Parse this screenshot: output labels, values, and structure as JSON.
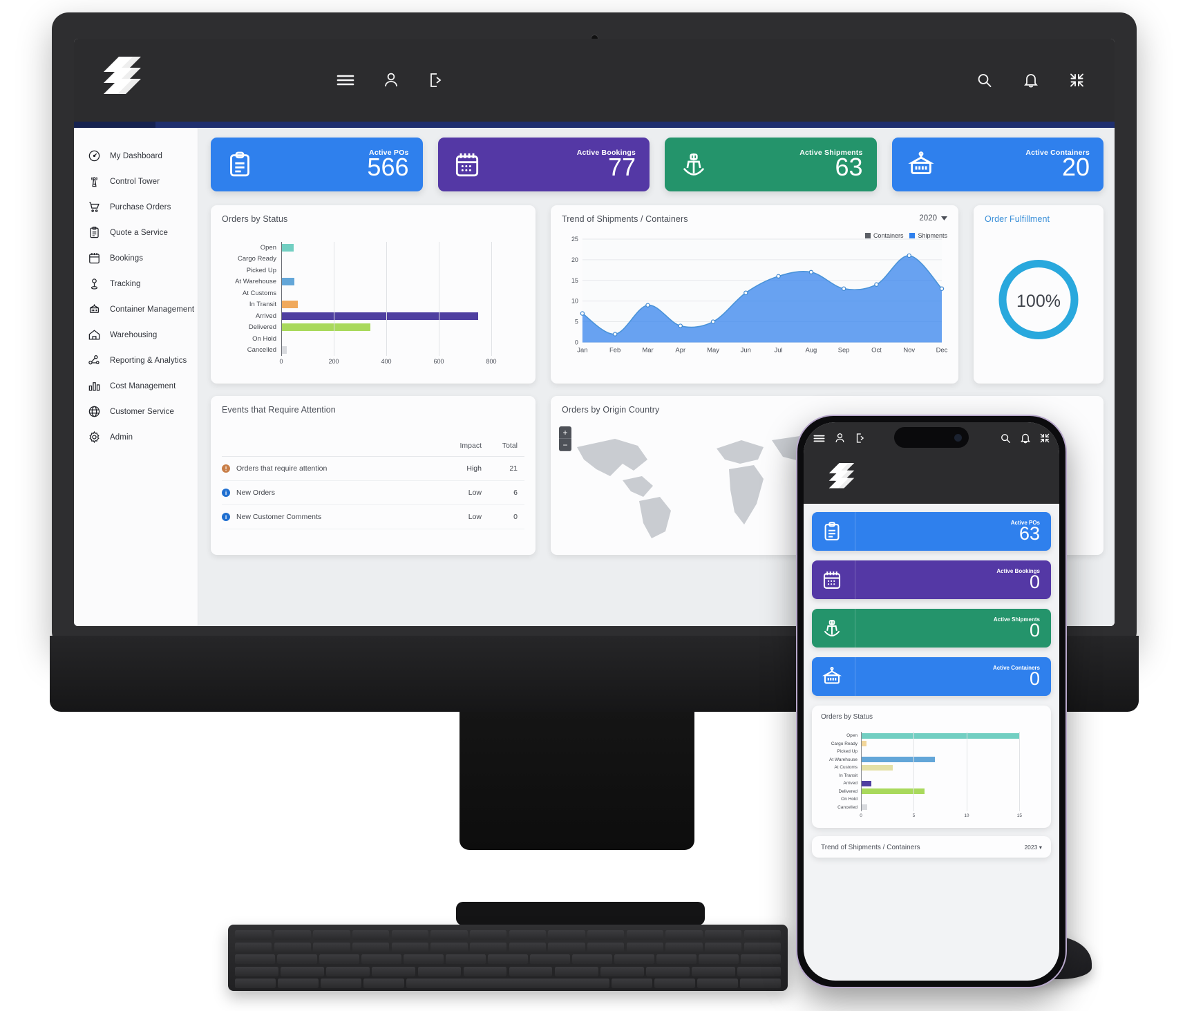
{
  "app": {
    "brand_logo": "stacked-slash-logo",
    "accent_navy": "#1f2f6e",
    "topbar_bg": "#2c2c2e"
  },
  "topbar": {
    "center_icons": [
      {
        "name": "menu-icon",
        "glyph": "hamburger"
      },
      {
        "name": "user-icon",
        "glyph": "person"
      },
      {
        "name": "logout-icon",
        "glyph": "exit-door"
      }
    ],
    "right_icons": [
      {
        "name": "search-icon",
        "glyph": "magnifier"
      },
      {
        "name": "notifications-icon",
        "glyph": "bell"
      },
      {
        "name": "fullscreen-icon",
        "glyph": "collapse-arrows"
      }
    ]
  },
  "sidebar": {
    "items": [
      {
        "label": "My Dashboard",
        "icon": "speedometer-icon"
      },
      {
        "label": "Control Tower",
        "icon": "broadcast-tower-icon"
      },
      {
        "label": "Purchase Orders",
        "icon": "shopping-cart-icon"
      },
      {
        "label": "Quote a Service",
        "icon": "clipboard-icon"
      },
      {
        "label": "Bookings",
        "icon": "calendar-icon"
      },
      {
        "label": "Tracking",
        "icon": "map-pin-icon"
      },
      {
        "label": "Container Management",
        "icon": "container-icon"
      },
      {
        "label": "Warehousing",
        "icon": "warehouse-icon"
      },
      {
        "label": "Reporting & Analytics",
        "icon": "network-nodes-icon"
      },
      {
        "label": "Cost Management",
        "icon": "bar-chart-icon"
      },
      {
        "label": "Customer Service",
        "icon": "globe-icon"
      },
      {
        "label": "Admin",
        "icon": "gear-icon"
      }
    ]
  },
  "kpis": [
    {
      "label": "Active POs",
      "value": "566",
      "color": "#2f80ed",
      "icon": "clipboard-icon"
    },
    {
      "label": "Active Bookings",
      "value": "77",
      "color": "#5438a5",
      "icon": "calendar-icon"
    },
    {
      "label": "Active Shipments",
      "value": "63",
      "color": "#24946b",
      "icon": "ship-icon"
    },
    {
      "label": "Active Containers",
      "value": "20",
      "color": "#2f80ed",
      "icon": "container-icon"
    }
  ],
  "panels": {
    "orders_by_status": {
      "title": "Orders by Status"
    },
    "trend": {
      "title": "Trend of Shipments / Containers",
      "year": "2020"
    },
    "fulfillment": {
      "title": "Order Fulfillment",
      "percent": "100%",
      "ring_color": "#29a8dd"
    },
    "events": {
      "title": "Events that Require Attention"
    },
    "origin": {
      "title": "Orders by Origin Country",
      "zoom_in": "+",
      "zoom_out": "−"
    }
  },
  "chart_data": [
    {
      "type": "bar",
      "orientation": "horizontal",
      "title": "Orders by Status",
      "categories": [
        "Open",
        "Cargo Ready",
        "Picked Up",
        "At Warehouse",
        "At Customs",
        "In Transit",
        "Arrived",
        "Delivered",
        "On Hold",
        "Cancelled"
      ],
      "values": [
        48,
        0,
        0,
        50,
        0,
        62,
        750,
        340,
        0,
        22
      ],
      "colors": [
        "#72cfc2",
        "#f2d69a",
        "#cfd3d8",
        "#63a6d8",
        "#e4e0a6",
        "#f0a95c",
        "#4f3fa0",
        "#a9d95c",
        "#cfd3d8",
        "#d8dade"
      ],
      "xlabel": "",
      "ylabel": "",
      "xlim": [
        0,
        900
      ],
      "xticks": [
        0,
        200,
        400,
        600,
        800
      ],
      "grid": true
    },
    {
      "type": "area",
      "title": "Trend of Shipments / Containers",
      "x": [
        "Jan",
        "Feb",
        "Mar",
        "Apr",
        "May",
        "Jun",
        "Jul",
        "Aug",
        "Sep",
        "Oct",
        "Nov",
        "Dec"
      ],
      "series": [
        {
          "name": "Shipments",
          "color": "#2f80ed",
          "values": [
            7,
            2,
            9,
            4,
            5,
            12,
            16,
            17,
            13,
            14,
            21,
            13
          ]
        },
        {
          "name": "Containers",
          "color": "#5c5f66",
          "values": []
        }
      ],
      "ylim": [
        0,
        25
      ],
      "yticks": [
        0,
        5,
        10,
        15,
        20,
        25
      ],
      "legend_position": "top-right",
      "grid": true
    },
    {
      "type": "pie",
      "title": "Order Fulfillment",
      "categories": [
        "Fulfilled"
      ],
      "values": [
        100
      ],
      "labels": [
        "100%"
      ],
      "donut": true
    },
    {
      "type": "bar",
      "orientation": "horizontal",
      "title": "Orders by Status (mobile)",
      "categories": [
        "Open",
        "Cargo Ready",
        "Picked Up",
        "At Warehouse",
        "At Customs",
        "In Transit",
        "Arrived",
        "Delivered",
        "On Hold",
        "Cancelled"
      ],
      "values": [
        15,
        0.5,
        0,
        7,
        3,
        0,
        1,
        6,
        0,
        0.6
      ],
      "colors": [
        "#72cfc2",
        "#f2d69a",
        "#cfd3d8",
        "#63a6d8",
        "#e4e0a6",
        "#f0a95c",
        "#4f3fa0",
        "#a9d95c",
        "#cfd3d8",
        "#d8dade"
      ],
      "xlim": [
        0,
        17
      ],
      "xticks": [
        0,
        5,
        10,
        15
      ],
      "grid": true
    }
  ],
  "events_table": {
    "columns": [
      "",
      "Impact",
      "Total"
    ],
    "col_impact": "Impact",
    "col_total": "Total",
    "rows": [
      {
        "name": "Orders that require attention",
        "impact": "High",
        "total": "21",
        "dot_color": "#c97f49",
        "dot_glyph": "!"
      },
      {
        "name": "New Orders",
        "impact": "Low",
        "total": "6",
        "dot_color": "#1f6fd0",
        "dot_glyph": "i"
      },
      {
        "name": "New Customer Comments",
        "impact": "Low",
        "total": "0",
        "dot_color": "#1f6fd0",
        "dot_glyph": "i"
      }
    ]
  },
  "phone": {
    "kpis": [
      {
        "label": "Active POs",
        "value": "63",
        "color": "#2f80ed",
        "icon": "clipboard-icon"
      },
      {
        "label": "Active Bookings",
        "value": "0",
        "color": "#5438a5",
        "icon": "calendar-icon"
      },
      {
        "label": "Active Shipments",
        "value": "0",
        "color": "#24946b",
        "icon": "ship-icon"
      },
      {
        "label": "Active Containers",
        "value": "0",
        "color": "#2f80ed",
        "icon": "container-icon"
      }
    ],
    "orders_panel_title": "Orders by Status",
    "trend_panel_title": "Trend of Shipments / Containers",
    "trend_year": "2023"
  }
}
